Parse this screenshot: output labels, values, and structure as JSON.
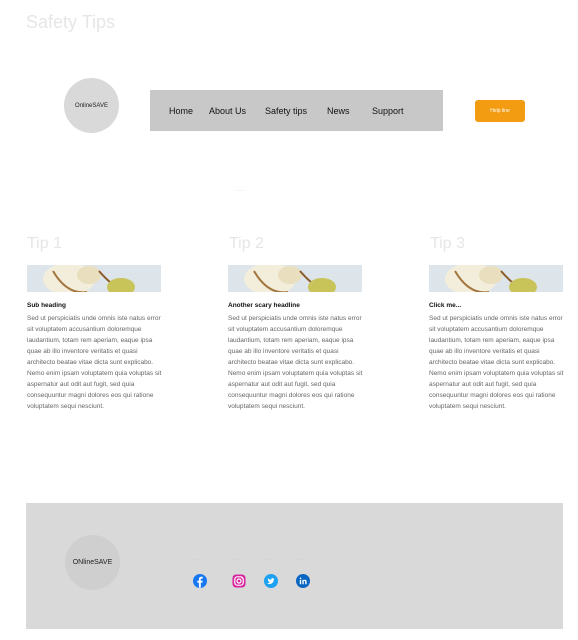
{
  "page": {
    "title": "Safety Tips"
  },
  "header": {
    "logo_text": "OnlineSAVE",
    "nav": [
      "Home",
      "About Us",
      "Safety tips",
      "News",
      "Support"
    ],
    "help_label": "Help line"
  },
  "middle_dots": "...",
  "tips": [
    {
      "title": "Tip 1",
      "heading": "Sub heading",
      "body": "Sed ut perspiciatis unde omnis iste natus error sit voluptatem accusantium doloremque laudantium, totam rem aperiam, eaque ipsa quae ab illo inventore veritatis et quasi architecto beatae vitae dicta sunt explicabo. Nemo enim ipsam voluptatem quia voluptas sit aspernatur aut odit aut fugit, sed quia consequuntur magni dolores eos qui ratione voluptatem sequi nesciunt."
    },
    {
      "title": "Tip 2",
      "heading": "Another scary headline",
      "body": "Sed ut perspiciatis unde omnis iste natus error sit voluptatem accusantium doloremque laudantium, totam rem aperiam, eaque ipsa quae ab illo inventore veritatis et quasi architecto beatae vitae dicta sunt explicabo. Nemo enim ipsam voluptatem quia voluptas sit aspernatur aut odit aut fugit, sed quia consequuntur magni dolores eos qui ratione voluptatem sequi nesciunt."
    },
    {
      "title": "Tip 3",
      "heading": "Click me...",
      "body": "Sed ut perspiciatis unde omnis iste natus error sit voluptatem accusantium doloremque laudantium, totam rem aperiam, eaque ipsa quae ab illo inventore veritatis et quasi architecto beatae vitae dicta sunt explicabo. Nemo enim ipsam voluptatem quia voluptas sit aspernatur aut odit aut fugit, sed quia consequuntur magni dolores eos qui ratione voluptatem sequi nesciunt."
    }
  ],
  "footer": {
    "logo_text": "ONlineSAVE",
    "social": [
      {
        "icon": "facebook-icon",
        "label": "...",
        "color": "#1877f2"
      },
      {
        "icon": "instagram-icon",
        "label": "...",
        "color": "#d6249f"
      },
      {
        "icon": "twitter-icon",
        "label": "...",
        "color": "#1da1f2"
      },
      {
        "icon": "linkedin-icon",
        "label": "...",
        "color": "#0a66c2"
      }
    ]
  },
  "colors": {
    "accent": "#f39c12",
    "nav_bg": "#c8c8c8",
    "footer_bg": "#d9d9d9"
  }
}
